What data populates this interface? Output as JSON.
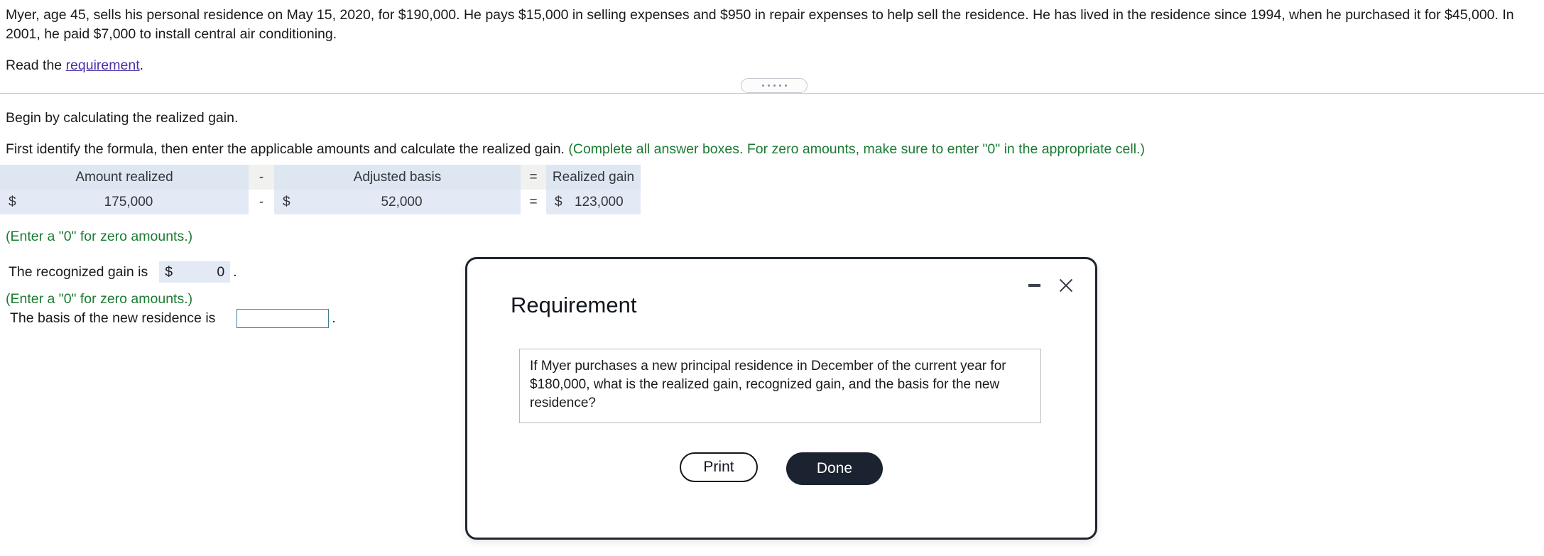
{
  "problem": {
    "statement": "Myer, age 45, sells his personal residence on May 15, 2020, for $190,000. He pays $15,000 in selling expenses and $950 in repair expenses to help sell the residence. He has lived in the residence since 1994, when he purchased it for $45,000. In 2001, he paid $7,000 to install central air conditioning.",
    "read_prefix": "Read the ",
    "read_link": "requirement",
    "read_suffix": "."
  },
  "work": {
    "begin_instruction": "Begin by calculating the realized gain.",
    "formula_instruction": "First identify the formula, then enter the applicable amounts and calculate the realized gain. ",
    "formula_instruction_note": "(Complete all answer boxes. For zero amounts, make sure to enter \"0\" in the appropriate cell.)",
    "table": {
      "headers": {
        "amount_realized": "Amount realized",
        "op_minus": "-",
        "adjusted_basis": "Adjusted basis",
        "op_equals": "=",
        "realized_gain": "Realized gain"
      },
      "values": {
        "dollar": "$",
        "amount_realized": "175,000",
        "op_minus": "-",
        "adjusted_basis": "52,000",
        "op_equals": "=",
        "realized_gain": "123,000"
      }
    },
    "note_zero_1": "(Enter a \"0\" for zero amounts.)",
    "recognized_gain_label": "The recognized gain is",
    "recognized_gain_dollar": "$",
    "recognized_gain_value": "0",
    "recognized_gain_period": ".",
    "note_zero_2": "(Enter a \"0\" for zero amounts.)",
    "basis_label": "The basis of the new residence is",
    "basis_value": "",
    "basis_placeholder": "",
    "basis_period": "."
  },
  "modal": {
    "title": "Requirement",
    "body": "If Myer purchases a new principal residence in December of the current year for $180,000, what is the realized gain, recognized gain, and the basis for the new residence?",
    "print_label": "Print",
    "done_label": "Done"
  },
  "colors": {
    "link": "#4b2fa8",
    "instruction_green": "#1c7a33",
    "table_header_bg": "#dee6f2",
    "table_value_bg": "#e3eaf5",
    "done_button_bg": "#1b2230",
    "input_border": "#3d7f93"
  }
}
